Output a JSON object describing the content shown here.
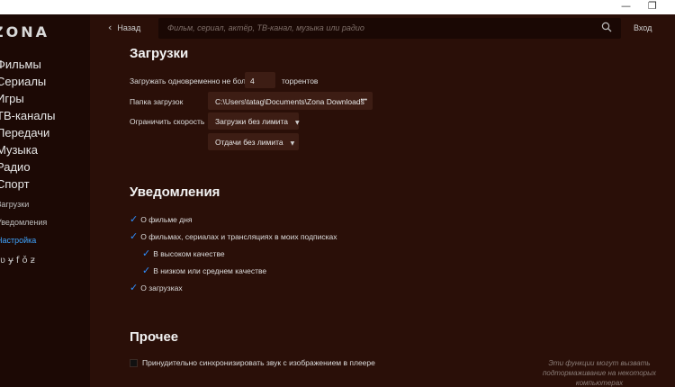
{
  "window": {
    "min_glyph": "—",
    "max_glyph": "❐"
  },
  "sidebar": {
    "logo": "ZONA",
    "items": [
      {
        "label": "Фильмы"
      },
      {
        "label": "Сериалы"
      },
      {
        "label": "Игры"
      },
      {
        "label": "ТВ-каналы"
      },
      {
        "label": "Передачи"
      },
      {
        "label": "Музыка"
      },
      {
        "label": "Радио"
      },
      {
        "label": "Спорт"
      },
      {
        "label": "Загрузки"
      },
      {
        "label": "Уведомления"
      },
      {
        "label": "Настройка"
      }
    ],
    "social": [
      "vk-icon",
      "twitter-icon",
      "facebook-icon",
      "odnoklassniki-icon",
      "zona-icon"
    ]
  },
  "topbar": {
    "back_label": "Назад",
    "search_placeholder": "Фильм, сериал, актёр, ТВ-канал, музыка или радио",
    "login_label": "Вход"
  },
  "downloads": {
    "title": "Загрузки",
    "simultaneous_prefix": "Загружать одновременно не более",
    "simultaneous_value": "4",
    "simultaneous_suffix": "торрентов",
    "folder_label": "Папка загрузок",
    "folder_path": "C:\\Users\\tatag\\Documents\\Zona Downloads",
    "folder_more": "•••",
    "limit_label": "Ограничить скорость",
    "download_limit": "Загрузки без лимита",
    "upload_limit": "Отдачи без лимита"
  },
  "notifications": {
    "title": "Уведомления",
    "items": [
      {
        "label": "О фильме дня",
        "checked": true
      },
      {
        "label": "О фильмах, сериалах и трансляциях в моих подписках",
        "checked": true
      },
      {
        "label": "В высоком качестве",
        "checked": true
      },
      {
        "label": "В низком или среднем качестве",
        "checked": true
      },
      {
        "label": "О загрузках",
        "checked": true
      }
    ]
  },
  "other": {
    "title": "Прочее",
    "sync_label": "Принудительно синхронизировать звук с изображением в плеере",
    "sync_checked": false,
    "note": "Эти функции могут вызвать подтормаживание на некоторых компьютерах"
  },
  "colors": {
    "background": "#2a0f08",
    "sidebar": "#1c0905",
    "accent": "#3fa4ff",
    "checkmark": "#2f8fff"
  }
}
